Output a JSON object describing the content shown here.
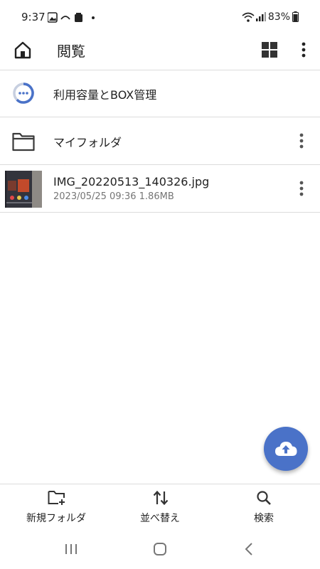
{
  "status": {
    "time": "9:37",
    "battery": "83%"
  },
  "appbar": {
    "title": "閲覧"
  },
  "rows": {
    "storage_label": "利用容量とBOX管理",
    "folder_label": "マイフォルダ",
    "file_name": "IMG_20220513_140326.jpg",
    "file_meta": "2023/05/25 09:36  1.86MB"
  },
  "bottom": {
    "new_folder": "新規フォルダ",
    "sort": "並べ替え",
    "search": "検索"
  },
  "colors": {
    "accent": "#4a72c8",
    "divider": "#dcdcdc",
    "secondary_text": "#757575"
  },
  "icons": [
    "home-icon",
    "grid-icon",
    "more-vert-icon",
    "storage-icon",
    "folder-icon",
    "cloud-upload-icon",
    "new-folder-icon",
    "sort-icon",
    "search-icon"
  ]
}
